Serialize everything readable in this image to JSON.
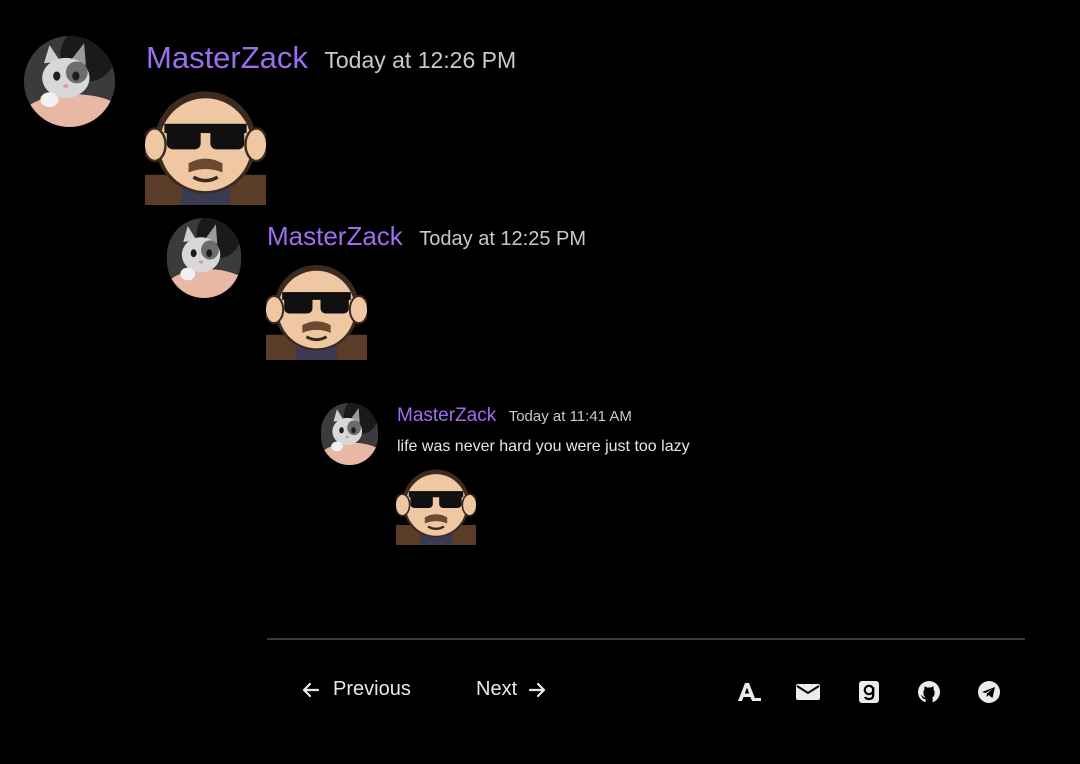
{
  "messages": [
    {
      "username": "MasterZack",
      "timestamp": "Today at 12:26 PM",
      "text": ""
    },
    {
      "username": "MasterZack",
      "timestamp": "Today at 12:25 PM",
      "text": ""
    },
    {
      "username": "MasterZack",
      "timestamp": "Today at 11:41 AM",
      "text": "life was never hard you were just too lazy"
    }
  ],
  "pagination": {
    "previous_label": "Previous",
    "next_label": "Next"
  },
  "social_icons": [
    "a-icon",
    "mail-icon",
    "g-icon",
    "github-icon",
    "telegram-icon"
  ],
  "colors": {
    "background": "#000000",
    "username": "#9b6ef0",
    "timestamp": "#c9c9c9",
    "divider": "#3a3a3a"
  }
}
